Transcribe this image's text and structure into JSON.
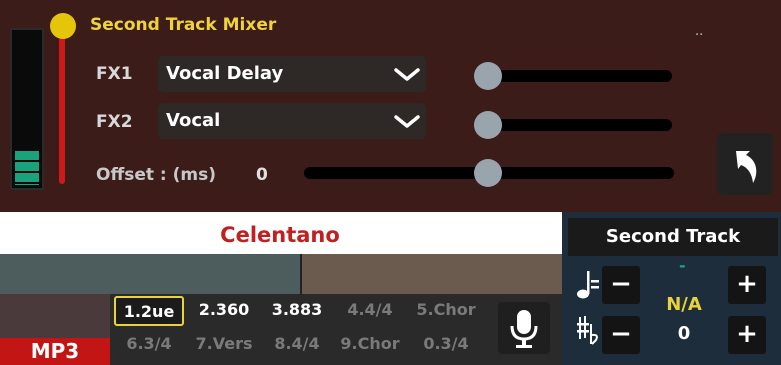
{
  "mixer": {
    "title": "Second Track Mixer",
    "dots": "..",
    "fx1": {
      "label": "FX1",
      "value": "Vocal Delay",
      "level": 0
    },
    "fx2": {
      "label": "FX2",
      "value": "Vocal",
      "level": 0
    },
    "offset": {
      "label": "Offset : (ms)",
      "value": "0"
    },
    "master_level": 1.0
  },
  "song": {
    "title": "Celentano",
    "format": "MP3"
  },
  "markers": {
    "row1": [
      {
        "label": "1.2ue",
        "state": "selected"
      },
      {
        "label": "2.360",
        "state": "on"
      },
      {
        "label": "3.883",
        "state": "on"
      },
      {
        "label": "4.4/4",
        "state": "off"
      },
      {
        "label": "5.Chor",
        "state": "off"
      }
    ],
    "row2": [
      {
        "label": "6.3/4",
        "state": "off"
      },
      {
        "label": "7.Vers",
        "state": "off"
      },
      {
        "label": "8.4/4",
        "state": "off"
      },
      {
        "label": "9.Chor",
        "state": "off"
      },
      {
        "label": "0.3/4",
        "state": "off"
      }
    ]
  },
  "second_track": {
    "title": "Second Track",
    "tempo": {
      "indicator": "-",
      "value": "N/A",
      "minus": "−",
      "plus": "+"
    },
    "transpose": {
      "value": "0",
      "minus": "−",
      "plus": "+"
    }
  },
  "icons": {
    "tempo": "note-tempo-icon",
    "transpose": "sharp-flat-icon",
    "mic": "microphone-icon",
    "back": "back-arrow-icon"
  },
  "colors": {
    "mixer_bg": "#3b1c19",
    "title": "#f0d23c",
    "song_title": "#c0201e",
    "format_badge": "#c41515",
    "value_yellow": "#e8d33a",
    "selected_border": "#e8d33a"
  }
}
